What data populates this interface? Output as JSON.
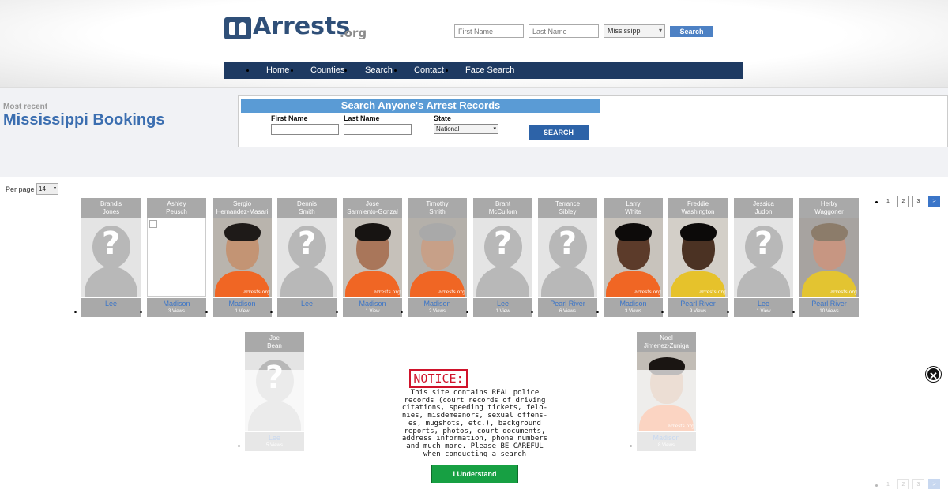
{
  "logo": {
    "text": "Arrests",
    "suffix": ".org"
  },
  "top_search": {
    "first_placeholder": "First Name",
    "last_placeholder": "Last Name",
    "state_selected": "Mississippi",
    "button": "Search"
  },
  "nav": [
    "Home",
    "Counties",
    "Search",
    "Contact",
    "Face Search"
  ],
  "band": {
    "subtitle": "Most recent",
    "title": "Mississippi Bookings"
  },
  "search_box": {
    "header": "Search Anyone's Arrest Records",
    "first_label": "First Name",
    "last_label": "Last Name",
    "state_label": "State",
    "state_selected": "National",
    "button": "SEARCH"
  },
  "per_page": {
    "label": "Per page",
    "value": "14"
  },
  "pagination": [
    "1",
    "2",
    "3",
    ">"
  ],
  "bookings": [
    {
      "first": "Brandis",
      "last": "Jones",
      "county": "Lee",
      "views": "",
      "photo": "placeholder"
    },
    {
      "first": "Ashley",
      "last": "Peusch",
      "county": "Madison",
      "views": "3 Views",
      "photo": "broken"
    },
    {
      "first": "Sergio",
      "last": "Hernandez-Masari",
      "county": "Madison",
      "views": "1 View",
      "photo": "mugshot"
    },
    {
      "first": "Dennis",
      "last": "Smith",
      "county": "Lee",
      "views": "",
      "photo": "placeholder"
    },
    {
      "first": "Jose",
      "last": "Sarmiento-Gonzal",
      "county": "Madison",
      "views": "1 View",
      "photo": "mugshot"
    },
    {
      "first": "Timothy",
      "last": "Smith",
      "county": "Madison",
      "views": "2 Views",
      "photo": "mugshot"
    },
    {
      "first": "Brant",
      "last": "McCullom",
      "county": "Lee",
      "views": "1 View",
      "photo": "placeholder"
    },
    {
      "first": "Terrance",
      "last": "Sibley",
      "county": "Pearl River",
      "views": "6 Views",
      "photo": "placeholder"
    },
    {
      "first": "Larry",
      "last": "White",
      "county": "Madison",
      "views": "3 Views",
      "photo": "mugshot"
    },
    {
      "first": "Freddie",
      "last": "Washington",
      "county": "Pearl River",
      "views": "9 Views",
      "photo": "mugshot"
    },
    {
      "first": "Jessica",
      "last": "Judon",
      "county": "Lee",
      "views": "1 View",
      "photo": "placeholder"
    },
    {
      "first": "Herby",
      "last": "Waggoner",
      "county": "Pearl River",
      "views": "10 Views",
      "photo": "mugshot"
    },
    {
      "first": "Joe",
      "last": "Bean",
      "county": "Lee",
      "views": "5 Views",
      "photo": "placeholder"
    },
    {
      "first": "Noel",
      "last": "Jimenez-Zuniga",
      "county": "Madison",
      "views": "8 Views",
      "photo": "mugshot"
    }
  ],
  "watermark": "arrests.org",
  "notice": {
    "title": "NOTICE:",
    "text": "This site contains REAL police records (court records of driving citations, speeding tickets, felo- nies, misdemeanors, sexual offens- es, mugshots, etc.), background reports, photos, court documents, address information, phone numbers and much more. Please BE CAREFUL when conducting a search",
    "button": "I Understand"
  },
  "colors": {
    "nav_bg": "#1e3a62",
    "accent_blue": "#3b6eb0",
    "search_header": "#5a9bd5",
    "notice_red": "#d0132b",
    "understand_green": "#17a043"
  },
  "icons": {
    "close": "close-icon"
  }
}
